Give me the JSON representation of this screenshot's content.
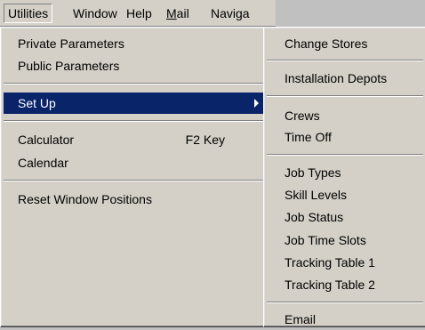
{
  "menubar": {
    "items": [
      {
        "label": "Utilities"
      },
      {
        "label": "Window"
      },
      {
        "label": "Help"
      },
      {
        "mnemonic": "M",
        "rest": "ail"
      },
      {
        "label": "Naviga"
      }
    ]
  },
  "utilities_menu": {
    "items": [
      {
        "label": "Private Parameters"
      },
      {
        "label": "Public Parameters"
      },
      {
        "label": "Set Up",
        "selected": true,
        "has_submenu": true
      },
      {
        "label": "Calculator",
        "shortcut": "F2 Key"
      },
      {
        "label": "Calendar"
      },
      {
        "label": "Reset Window Positions"
      }
    ]
  },
  "setup_submenu": {
    "items": [
      {
        "label": "Change Stores"
      },
      {
        "label": "Installation Depots"
      },
      {
        "label": "Crews"
      },
      {
        "label": "Time Off"
      },
      {
        "label": "Job Types"
      },
      {
        "label": "Skill Levels"
      },
      {
        "label": "Job Status"
      },
      {
        "label": "Job Time Slots"
      },
      {
        "label": "Tracking Table 1"
      },
      {
        "label": "Tracking Table 2"
      },
      {
        "label": "Email"
      }
    ]
  }
}
